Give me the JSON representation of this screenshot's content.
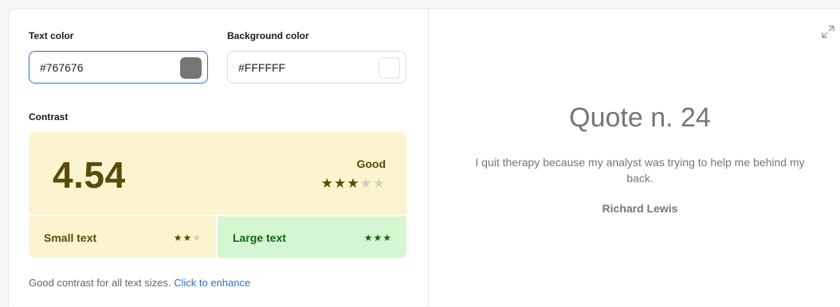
{
  "text_color": {
    "label": "Text color",
    "value": "#767676",
    "swatch": "#767676"
  },
  "background_color": {
    "label": "Background color",
    "value": "#FFFFFF",
    "swatch": "#FFFFFF"
  },
  "contrast": {
    "label": "Contrast",
    "ratio": "4.54",
    "grade": "Good",
    "stars_filled": 3,
    "stars_total": 5,
    "small_text": {
      "label": "Small text",
      "stars_filled": 2,
      "stars_total": 3
    },
    "large_text": {
      "label": "Large text",
      "stars_filled": 3,
      "stars_total": 3
    }
  },
  "status": {
    "message": "Good contrast for all text sizes.",
    "link": "Click to enhance"
  },
  "preview": {
    "title": "Quote n. 24",
    "body": "I quit therapy because my analyst was trying to help me behind my back.",
    "author": "Richard Lewis"
  },
  "colors": {
    "focus_border": "#2f6fd6",
    "score_bg": "#fbf4cf",
    "large_bg": "#d4f7d2",
    "score_text": "#5a4a08",
    "large_text": "#136313"
  }
}
